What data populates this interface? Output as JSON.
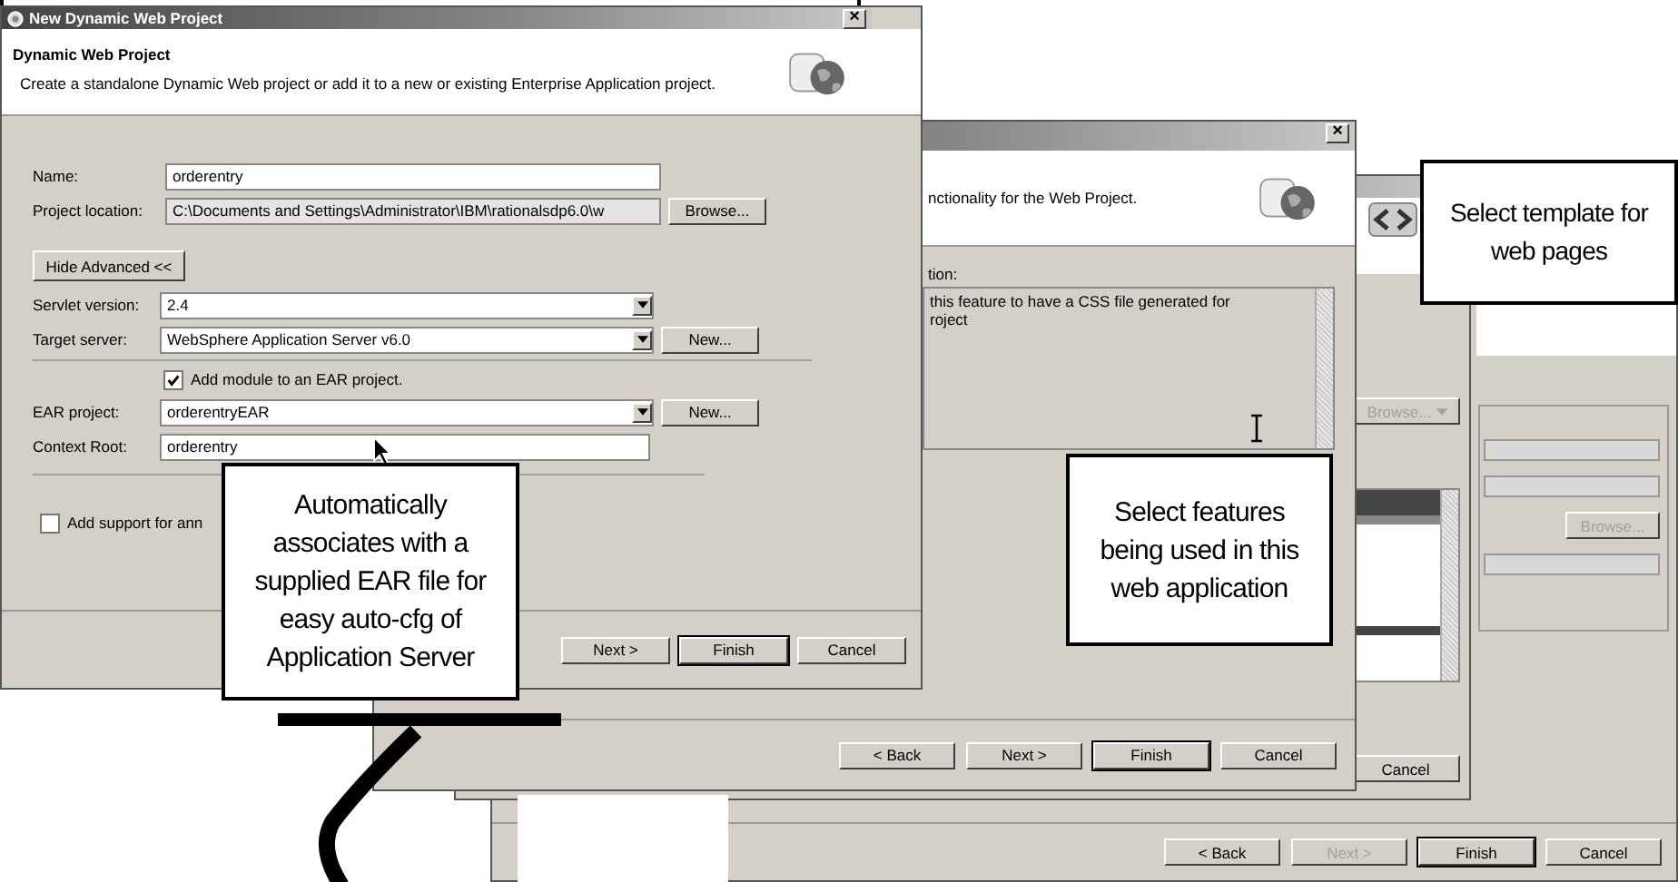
{
  "main_dialog": {
    "title": "New Dynamic Web Project",
    "close": "×",
    "header_title": "Dynamic Web Project",
    "header_text": "Create a standalone Dynamic Web project or add it to a new or existing Enterprise Application project.",
    "basic_fields": [
      {
        "label": "Name:",
        "value": "orderentry",
        "readonly": false
      },
      {
        "label": "Project location:",
        "value": "C:\\Documents and Settings\\Administrator\\IBM\\rationalsdp6.0\\w",
        "readonly": true,
        "button": "Browse..."
      }
    ],
    "advanced_toggle": "Hide Advanced <<",
    "advanced_fields": [
      {
        "kind": "select",
        "label": "Servlet version:",
        "value": "2.4"
      },
      {
        "kind": "select",
        "label": "Target server:",
        "value": "WebSphere Application Server v6.0",
        "button": "New..."
      },
      {
        "kind": "checkbox",
        "label": "Add module to an EAR project.",
        "checked": true
      },
      {
        "kind": "select",
        "label": "EAR project:",
        "value": "orderentryEAR",
        "button": "New..."
      },
      {
        "kind": "field",
        "label": "Context Root:",
        "value": "orderentry",
        "readonly": false
      }
    ],
    "options": [
      {
        "label": "Add support for ann",
        "checked": false
      }
    ],
    "buttons": [
      {
        "label": "Next >",
        "default": false,
        "disabled": false
      },
      {
        "label": "Finish",
        "default": true,
        "disabled": false
      },
      {
        "label": "Cancel",
        "default": false,
        "disabled": false
      }
    ]
  },
  "features_dialog": {
    "close": "×",
    "header_text": "nctionality for the Web Project.",
    "description_label": "tion:",
    "description_lines": [
      "this feature to have a CSS file generated for",
      "roject"
    ],
    "buttons": [
      {
        "label": "< Back",
        "default": false,
        "disabled": false
      },
      {
        "label": "Next >",
        "default": false,
        "disabled": false
      },
      {
        "label": "Finish",
        "default": true,
        "disabled": false
      },
      {
        "label": "Cancel",
        "default": false,
        "disabled": false
      }
    ]
  },
  "middle_dialog": {
    "browse_button": {
      "label": "Browse...",
      "disabled": true
    },
    "buttons": [
      {
        "label": "Cancel",
        "default": false,
        "disabled": false
      }
    ]
  },
  "template_dialog": {
    "browse_button": {
      "label": "Browse...",
      "disabled": true
    },
    "buttons": [
      {
        "label": "< Back",
        "default": false,
        "disabled": false
      },
      {
        "label": "Next >",
        "default": false,
        "disabled": true
      },
      {
        "label": "Finish",
        "default": true,
        "disabled": false
      },
      {
        "label": "Cancel",
        "default": false,
        "disabled": false
      }
    ]
  },
  "callouts": [
    "Automatically associates with a supplied EAR file for easy auto-cfg of Application Server",
    "Select features being used in this web application",
    "Select template for web pages"
  ]
}
